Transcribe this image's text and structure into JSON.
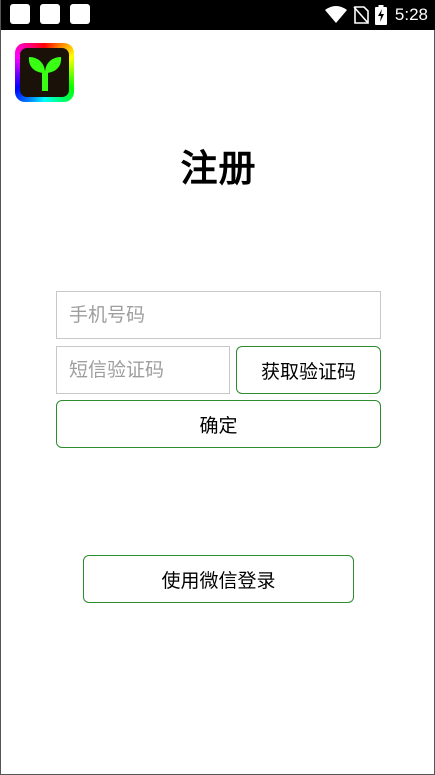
{
  "status_bar": {
    "time": "5:28"
  },
  "app": {
    "logo_icon": "sprout-icon"
  },
  "page": {
    "title": "注册"
  },
  "form": {
    "phone_placeholder": "手机号码",
    "sms_placeholder": "短信验证码",
    "get_code_label": "获取验证码",
    "confirm_label": "确定"
  },
  "wechat": {
    "login_label": "使用微信登录"
  },
  "colors": {
    "button_border": "#2e8b2e",
    "input_border": "#c8c8c8",
    "status_bar_bg": "#000000"
  }
}
